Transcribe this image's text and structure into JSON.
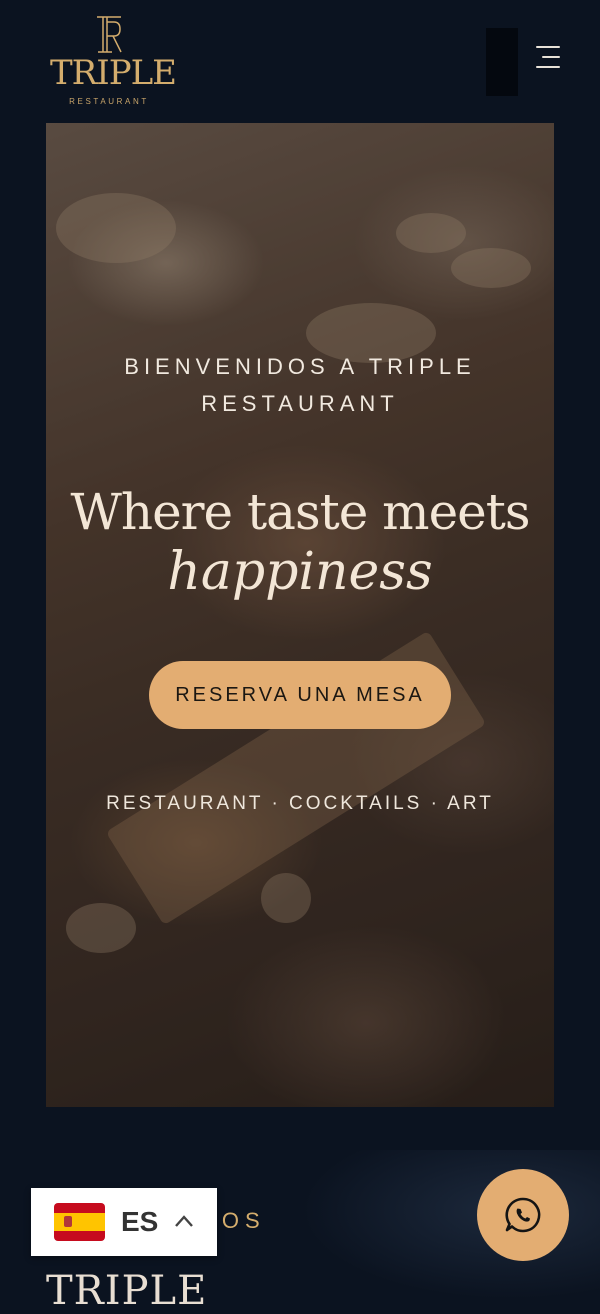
{
  "header": {
    "logo_name": "TRIPLE",
    "logo_sub": "RESTAURANT",
    "menu_icon": "hamburger-icon"
  },
  "hero": {
    "kicker_line1": "BIENVENIDOS A TRIPLE",
    "kicker_line2": "RESTAURANT",
    "title": "Where taste meets",
    "title_italic": "happiness",
    "cta_label": "RESERVA UNA MESA",
    "tagline": "RESTAURANT · COCKTAILS · ART"
  },
  "section": {
    "kicker": "NOS",
    "title": "TRIPLE"
  },
  "language_switcher": {
    "code": "ES",
    "flag_icon": "spain-flag-icon",
    "chevron_icon": "chevron-up-icon"
  },
  "whatsapp": {
    "icon": "whatsapp-icon"
  },
  "colors": {
    "background": "#0b1320",
    "accent": "#e3ad72",
    "gold": "#d4ad6d",
    "text_light": "#efe6da"
  }
}
